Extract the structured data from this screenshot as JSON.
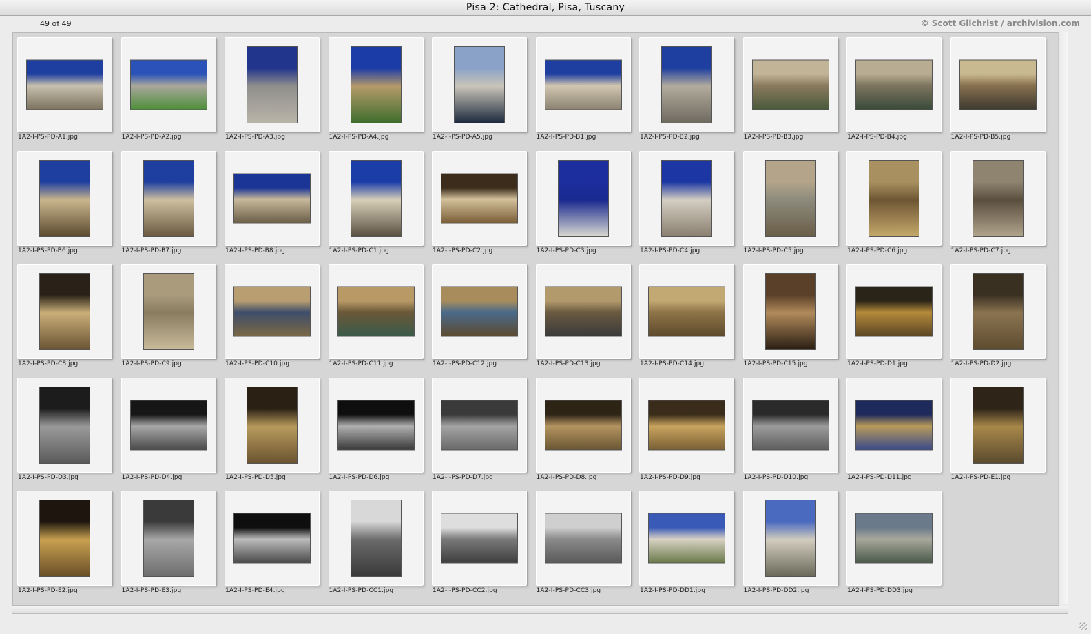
{
  "window": {
    "title": "Pisa 2: Cathedral, Pisa, Tuscany"
  },
  "header": {
    "count": "49 of 49",
    "credit": "© Scott Gilchrist / archivision.com"
  },
  "thumbnails": [
    {
      "file": "1A2-I-PS-PD-A1.jpg",
      "orient": "land",
      "colors": [
        "#1f3fa0",
        "#c8c0ae",
        "#7c7460"
      ]
    },
    {
      "file": "1A2-I-PS-PD-A2.jpg",
      "orient": "land",
      "colors": [
        "#2a52b8",
        "#a9a79c",
        "#4f8f3a"
      ]
    },
    {
      "file": "1A2-I-PS-PD-A3.jpg",
      "orient": "port",
      "colors": [
        "#22358c",
        "#8f8f8c",
        "#b9b4a8"
      ]
    },
    {
      "file": "1A2-I-PS-PD-A4.jpg",
      "orient": "port",
      "colors": [
        "#1b3ba6",
        "#b49a6a",
        "#3f6e2c"
      ]
    },
    {
      "file": "1A2-I-PS-PD-A5.jpg",
      "orient": "port",
      "colors": [
        "#8aa2c8",
        "#c9c4b8",
        "#1d2b3f"
      ]
    },
    {
      "file": "1A2-I-PS-PD-B1.jpg",
      "orient": "land",
      "colors": [
        "#1f3fa0",
        "#d0c6b0",
        "#8d8373"
      ]
    },
    {
      "file": "1A2-I-PS-PD-B2.jpg",
      "orient": "port",
      "colors": [
        "#1f3fa0",
        "#b2ab9d",
        "#6f6a60"
      ]
    },
    {
      "file": "1A2-I-PS-PD-B3.jpg",
      "orient": "land",
      "colors": [
        "#c2b496",
        "#8a7a5e",
        "#4a5a3c"
      ]
    },
    {
      "file": "1A2-I-PS-PD-B4.jpg",
      "orient": "land",
      "colors": [
        "#b8ac92",
        "#7d745e",
        "#3a4a3a"
      ]
    },
    {
      "file": "1A2-I-PS-PD-B5.jpg",
      "orient": "land",
      "colors": [
        "#c9b990",
        "#86704e",
        "#3f3a30"
      ]
    },
    {
      "file": "1A2-I-PS-PD-B6.jpg",
      "orient": "port",
      "colors": [
        "#1f3fa0",
        "#c9b48c",
        "#5c4b30"
      ]
    },
    {
      "file": "1A2-I-PS-PD-B7.jpg",
      "orient": "port",
      "colors": [
        "#1f3fa0",
        "#cdbf9f",
        "#6a5a42"
      ]
    },
    {
      "file": "1A2-I-PS-PD-B8.jpg",
      "orient": "land",
      "colors": [
        "#1b3596",
        "#c6b89a",
        "#6b5e48"
      ]
    },
    {
      "file": "1A2-I-PS-PD-C1.jpg",
      "orient": "port",
      "colors": [
        "#1b3da8",
        "#d8cfb8",
        "#5a5042"
      ]
    },
    {
      "file": "1A2-I-PS-PD-C2.jpg",
      "orient": "land",
      "colors": [
        "#3b2c1c",
        "#d2c09a",
        "#7a5e38"
      ]
    },
    {
      "file": "1A2-I-PS-PD-C3.jpg",
      "orient": "port",
      "colors": [
        "#1c2d9e",
        "#1a2a90",
        "#d8d8d0"
      ]
    },
    {
      "file": "1A2-I-PS-PD-C4.jpg",
      "orient": "port",
      "colors": [
        "#1c37a3",
        "#d4cec2",
        "#8a7f70"
      ]
    },
    {
      "file": "1A2-I-PS-PD-C5.jpg",
      "orient": "port",
      "colors": [
        "#b4a58a",
        "#8c8a7c",
        "#6a5e48"
      ]
    },
    {
      "file": "1A2-I-PS-PD-C6.jpg",
      "orient": "port",
      "colors": [
        "#a89060",
        "#6e5634",
        "#c4a86a"
      ]
    },
    {
      "file": "1A2-I-PS-PD-C7.jpg",
      "orient": "port",
      "colors": [
        "#8f8470",
        "#5a4e3e",
        "#b0a48c"
      ]
    },
    {
      "file": "1A2-I-PS-PD-C8.jpg",
      "orient": "port",
      "colors": [
        "#2a2218",
        "#c9ae78",
        "#6a5434"
      ]
    },
    {
      "file": "1A2-I-PS-PD-C9.jpg",
      "orient": "port",
      "colors": [
        "#a99b7c",
        "#8a7c60",
        "#c8bb9a"
      ]
    },
    {
      "file": "1A2-I-PS-PD-C10.jpg",
      "orient": "land",
      "colors": [
        "#b89e70",
        "#3e4e6a",
        "#7a6846"
      ]
    },
    {
      "file": "1A2-I-PS-PD-C11.jpg",
      "orient": "land",
      "colors": [
        "#b99a66",
        "#6a5838",
        "#3a5a4a"
      ]
    },
    {
      "file": "1A2-I-PS-PD-C12.jpg",
      "orient": "land",
      "colors": [
        "#a88c5c",
        "#4a6a8a",
        "#5c4a30"
      ]
    },
    {
      "file": "1A2-I-PS-PD-C13.jpg",
      "orient": "land",
      "colors": [
        "#b39a6c",
        "#6a5a40",
        "#3a3a3a"
      ]
    },
    {
      "file": "1A2-I-PS-PD-C14.jpg",
      "orient": "land",
      "colors": [
        "#c2a872",
        "#8e7448",
        "#5e4a2c"
      ]
    },
    {
      "file": "1A2-I-PS-PD-C15.jpg",
      "orient": "port",
      "colors": [
        "#5a4028",
        "#b08a5a",
        "#2a1e14"
      ]
    },
    {
      "file": "1A2-I-PS-PD-D1.jpg",
      "orient": "land",
      "colors": [
        "#2a2418",
        "#b48a3a",
        "#5c4624"
      ]
    },
    {
      "file": "1A2-I-PS-PD-D2.jpg",
      "orient": "port",
      "colors": [
        "#3a3022",
        "#8a7450",
        "#5e4c30"
      ]
    },
    {
      "file": "1A2-I-PS-PD-D3.jpg",
      "orient": "port",
      "colors": [
        "#1c1c1c",
        "#9a9a9a",
        "#5a5a5a"
      ]
    },
    {
      "file": "1A2-I-PS-PD-D4.jpg",
      "orient": "land",
      "colors": [
        "#161616",
        "#a8a8a8",
        "#4a4a4a"
      ]
    },
    {
      "file": "1A2-I-PS-PD-D5.jpg",
      "orient": "port",
      "colors": [
        "#2a2014",
        "#b89a5c",
        "#6a5430"
      ]
    },
    {
      "file": "1A2-I-PS-PD-D6.jpg",
      "orient": "land",
      "colors": [
        "#0e0e0e",
        "#b0b0b0",
        "#3a3a3a"
      ]
    },
    {
      "file": "1A2-I-PS-PD-D7.jpg",
      "orient": "land",
      "colors": [
        "#3a3a3a",
        "#a4a4a4",
        "#6a6a6a"
      ]
    },
    {
      "file": "1A2-I-PS-PD-D8.jpg",
      "orient": "land",
      "colors": [
        "#2e2416",
        "#b49460",
        "#6a5634"
      ]
    },
    {
      "file": "1A2-I-PS-PD-D9.jpg",
      "orient": "land",
      "colors": [
        "#3a2c1a",
        "#c8a45e",
        "#7a6036"
      ]
    },
    {
      "file": "1A2-I-PS-PD-D10.jpg",
      "orient": "land",
      "colors": [
        "#2a2a2a",
        "#9c9c9c",
        "#5e5e5e"
      ]
    },
    {
      "file": "1A2-I-PS-PD-D11.jpg",
      "orient": "land",
      "colors": [
        "#1e2a5c",
        "#b89a5a",
        "#3a4a8a"
      ]
    },
    {
      "file": "1A2-I-PS-PD-E1.jpg",
      "orient": "port",
      "colors": [
        "#2e2418",
        "#a8884a",
        "#5a4a2e"
      ]
    },
    {
      "file": "1A2-I-PS-PD-E2.jpg",
      "orient": "port",
      "colors": [
        "#1e160e",
        "#c8a050",
        "#6a5028"
      ]
    },
    {
      "file": "1A2-I-PS-PD-E3.jpg",
      "orient": "port",
      "colors": [
        "#3a3a3a",
        "#a8a8a8",
        "#6e6e6e"
      ]
    },
    {
      "file": "1A2-I-PS-PD-E4.jpg",
      "orient": "land",
      "colors": [
        "#0e0e0e",
        "#bcbcbc",
        "#4a4a4a"
      ]
    },
    {
      "file": "1A2-I-PS-PD-CC1.jpg",
      "orient": "port",
      "colors": [
        "#d8d8d8",
        "#6a6a6a",
        "#3a3a3a"
      ]
    },
    {
      "file": "1A2-I-PS-PD-CC2.jpg",
      "orient": "land",
      "colors": [
        "#dedede",
        "#7a7a7a",
        "#3e3e3e"
      ]
    },
    {
      "file": "1A2-I-PS-PD-CC3.jpg",
      "orient": "land",
      "colors": [
        "#cfcfcf",
        "#8a8a8a",
        "#5a5a5a"
      ]
    },
    {
      "file": "1A2-I-PS-PD-DD1.jpg",
      "orient": "land",
      "colors": [
        "#3a5ab8",
        "#d8d2c4",
        "#6a7a4a"
      ]
    },
    {
      "file": "1A2-I-PS-PD-DD2.jpg",
      "orient": "port",
      "colors": [
        "#4a6ac0",
        "#d2ccbe",
        "#6a6a5a"
      ]
    },
    {
      "file": "1A2-I-PS-PD-DD3.jpg",
      "orient": "land",
      "colors": [
        "#6a7a8a",
        "#a8a89c",
        "#4a5a4a"
      ]
    }
  ]
}
